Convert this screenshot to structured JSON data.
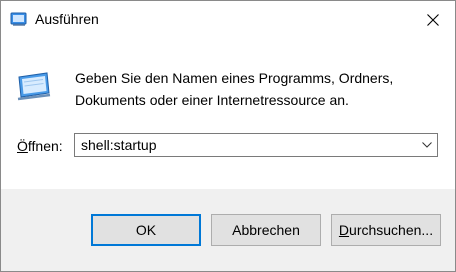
{
  "window": {
    "title": "Ausführen",
    "close_icon": "close-icon"
  },
  "prompt": {
    "line1": "Geben Sie den Namen eines Programms, Ordners,",
    "line2": "Dokuments oder einer Internetressource an."
  },
  "open_field": {
    "label_accel": "Ö",
    "label_rest": "ffnen:",
    "value": "shell:startup",
    "dropdown_icon": "chevron-down-icon"
  },
  "buttons": {
    "ok": "OK",
    "cancel": "Abbrechen",
    "browse_accel": "D",
    "browse_rest": "urchsuchen..."
  },
  "colors": {
    "accent": "#0078d7",
    "footer_bg": "#f0f0f0",
    "button_bg": "#e1e1e1"
  }
}
